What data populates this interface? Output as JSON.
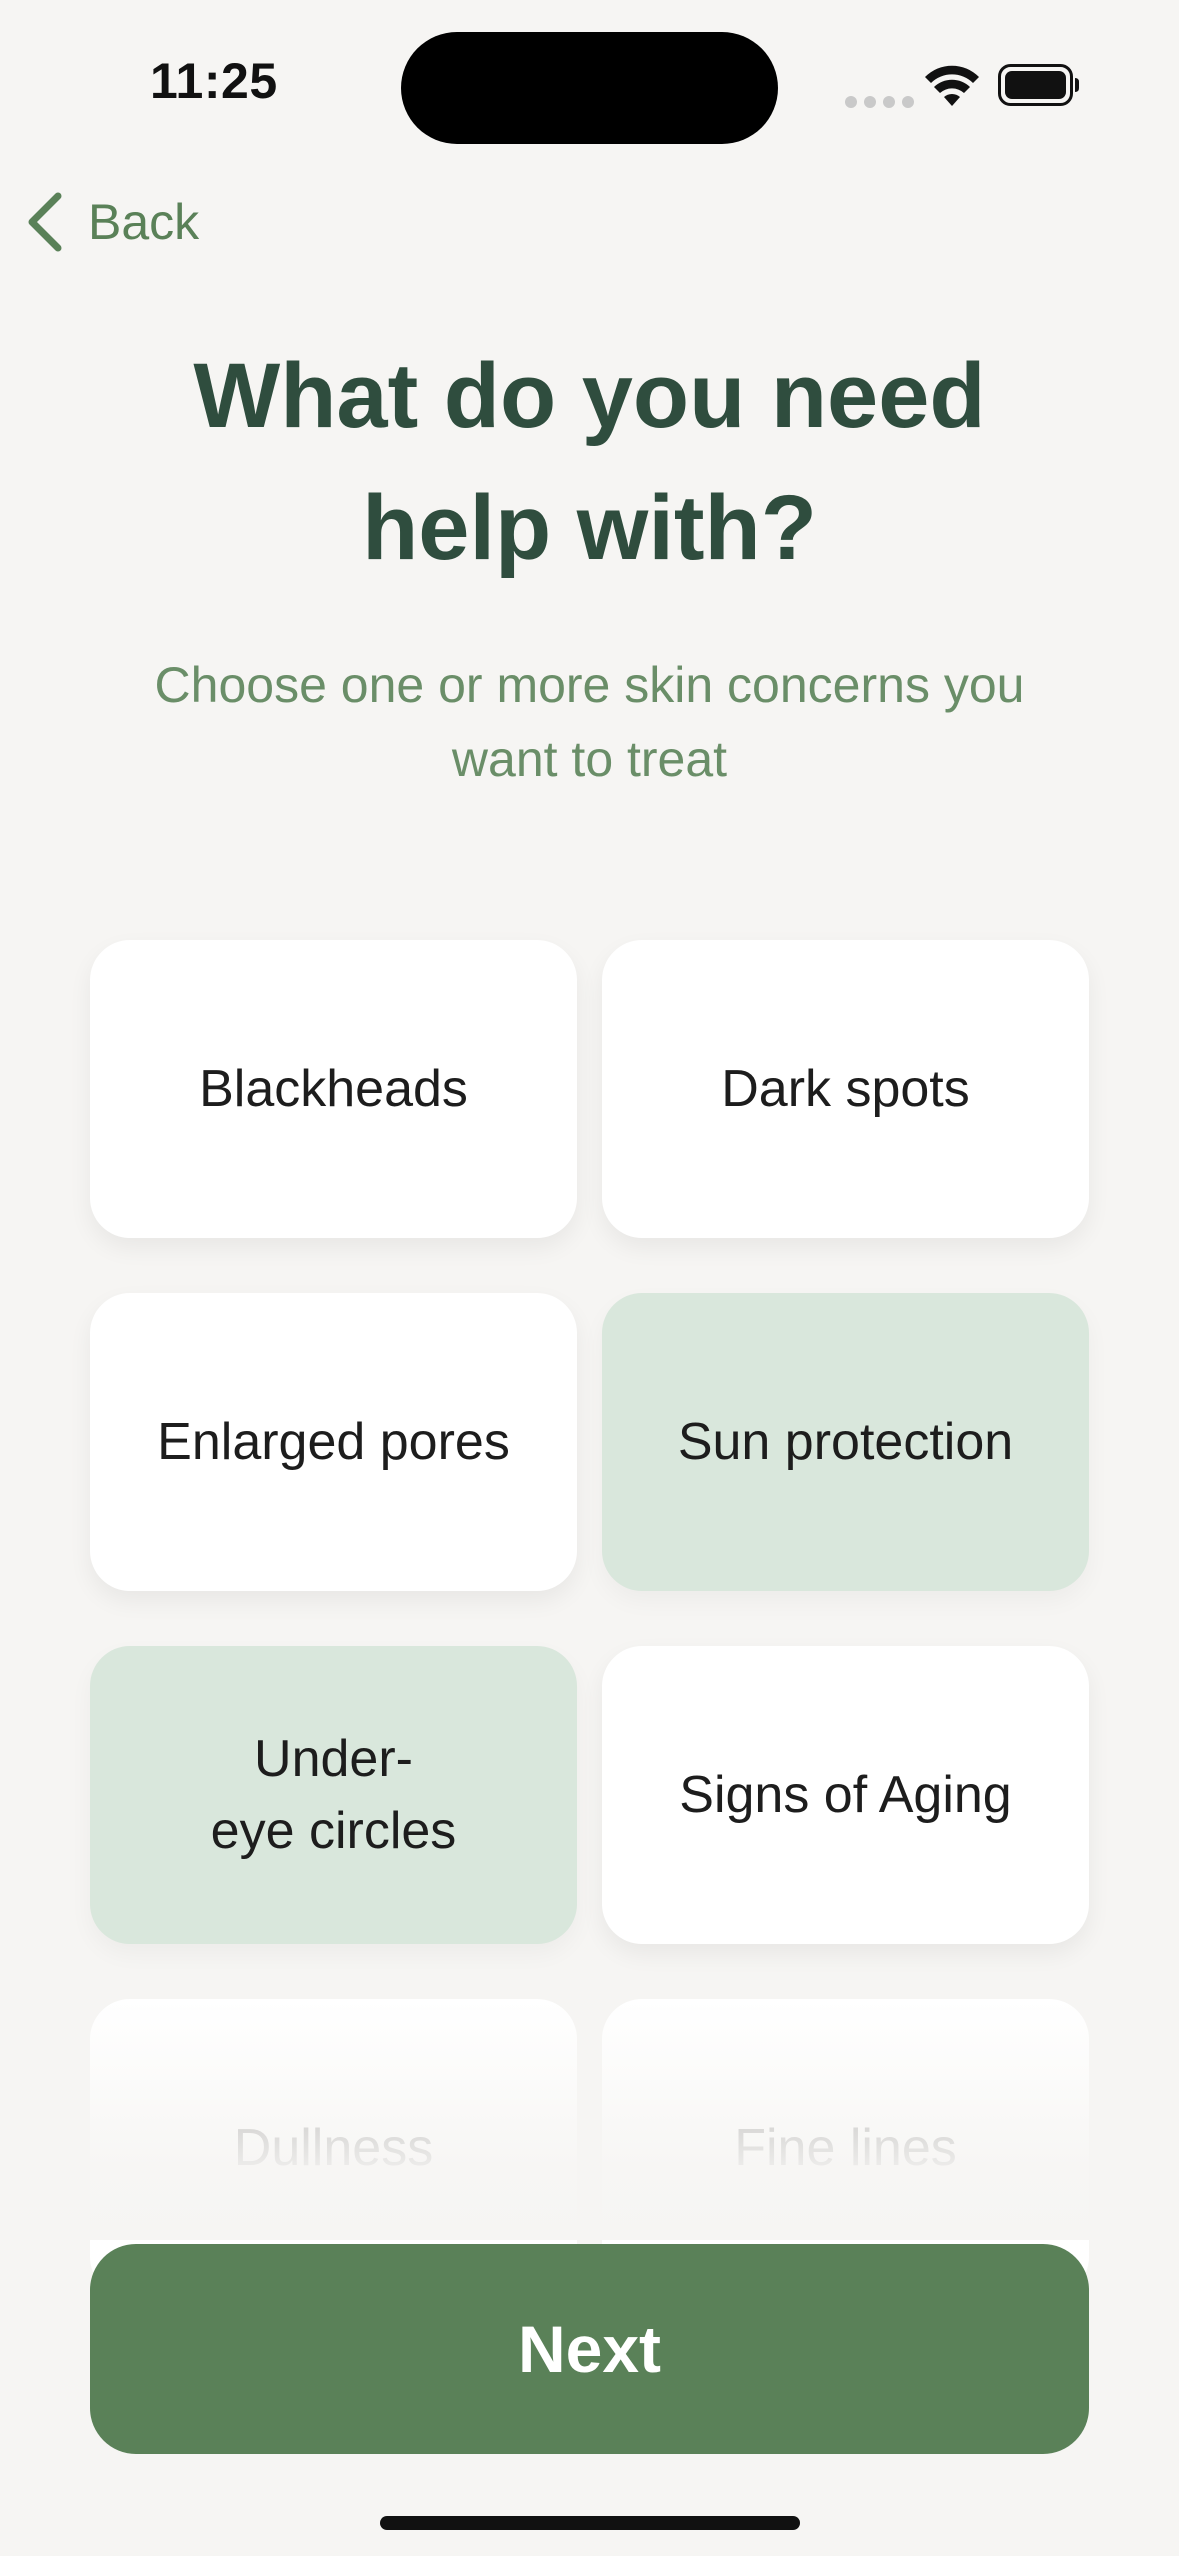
{
  "status_bar": {
    "time": "11:25"
  },
  "nav": {
    "back_label": "Back"
  },
  "header": {
    "title": "What do you need help with?",
    "subtitle": "Choose one or more skin concerns you want to treat"
  },
  "options": [
    {
      "label": "Blackheads",
      "selected": false
    },
    {
      "label": "Dark spots",
      "selected": false
    },
    {
      "label": "Enlarged pores",
      "selected": false
    },
    {
      "label": "Sun protection",
      "selected": true
    },
    {
      "label": "Under-\neye circles",
      "selected": true
    },
    {
      "label": "Signs of Aging",
      "selected": false
    },
    {
      "label": "Dullness",
      "selected": false
    },
    {
      "label": "Fine lines",
      "selected": false
    }
  ],
  "actions": {
    "next_label": "Next"
  },
  "colors": {
    "accent": "#5a8158",
    "title": "#2f4d3e",
    "selected_bg": "#d9e7dc",
    "background": "#f6f5f3"
  }
}
